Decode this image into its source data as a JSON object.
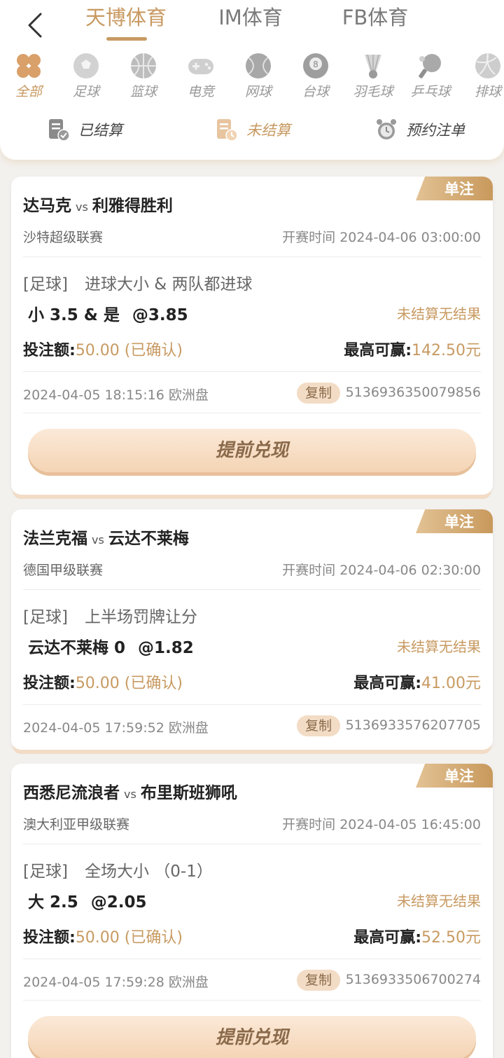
{
  "header": {
    "platforms": [
      {
        "label": "天博体育",
        "active": true
      },
      {
        "label": "IM体育",
        "active": false
      },
      {
        "label": "FB体育",
        "active": false
      }
    ],
    "sports": [
      {
        "label": "全部",
        "icon": "clover-icon",
        "active": true
      },
      {
        "label": "足球",
        "icon": "soccer-ball-icon"
      },
      {
        "label": "篮球",
        "icon": "basketball-icon"
      },
      {
        "label": "电竞",
        "icon": "gamepad-icon"
      },
      {
        "label": "网球",
        "icon": "tennis-ball-icon"
      },
      {
        "label": "台球",
        "icon": "billiard-ball-icon"
      },
      {
        "label": "羽毛球",
        "icon": "shuttlecock-icon"
      },
      {
        "label": "乒乓球",
        "icon": "ping-pong-icon"
      },
      {
        "label": "排球",
        "icon": "volleyball-icon"
      }
    ],
    "status_tabs": [
      {
        "label": "已结算",
        "icon": "settled-doc-icon"
      },
      {
        "label": "未结算",
        "icon": "unsettled-doc-icon",
        "active": true
      },
      {
        "label": "预约注单",
        "icon": "alarm-clock-icon"
      }
    ]
  },
  "bets": [
    {
      "badge": "单注",
      "home": "达马克",
      "vs": "vs",
      "away": "利雅得胜利",
      "league": "沙特超级联赛",
      "start_time": "开赛时间 2024-04-06 03:00:00",
      "sport_tag": "[足球]",
      "market": "进球大小 & 两队都进球",
      "selection": "小 3.5 & 是",
      "odds": "@3.85",
      "result": "未结算无结果",
      "stake_label": "投注额:",
      "stake_value": "50.00 (已确认)",
      "maxwin_label": "最高可赢:",
      "maxwin_value": "142.50元",
      "bet_time": "2024-04-05 18:15:16 欧洲盘",
      "copy_label": "复制",
      "order_no": "5136936350079856",
      "cashout_label": "提前兑现"
    },
    {
      "badge": "单注",
      "home": "法兰克福",
      "vs": "vs",
      "away": "云达不莱梅",
      "league": "德国甲级联赛",
      "start_time": "开赛时间 2024-04-06 02:30:00",
      "sport_tag": "[足球]",
      "market": "上半场罚牌让分",
      "selection": "云达不莱梅  0",
      "odds": "@1.82",
      "result": "未结算无结果",
      "stake_label": "投注额:",
      "stake_value": "50.00 (已确认)",
      "maxwin_label": "最高可赢:",
      "maxwin_value": "41.00元",
      "bet_time": "2024-04-05 17:59:52 欧洲盘",
      "copy_label": "复制",
      "order_no": "5136933576207705"
    },
    {
      "badge": "单注",
      "home": "西悉尼流浪者",
      "vs": "vs",
      "away": "布里斯班狮吼",
      "league": "澳大利亚甲级联赛",
      "start_time": "开赛时间 2024-04-05 16:45:00",
      "sport_tag": "[足球]",
      "market": "全场大小 （0-1）",
      "selection": "大 2.5",
      "odds": "@2.05",
      "result": "未结算无结果",
      "stake_label": "投注额:",
      "stake_value": "50.00 (已确认)",
      "maxwin_label": "最高可赢:",
      "maxwin_value": "52.50元",
      "bet_time": "2024-04-05 17:59:28 欧洲盘",
      "copy_label": "复制",
      "order_no": "5136933506700274",
      "cashout_label": "提前兑现"
    }
  ],
  "colors": {
    "accent": "#c89a62",
    "badge_from": "#e2c294",
    "badge_to": "#c8995c"
  }
}
